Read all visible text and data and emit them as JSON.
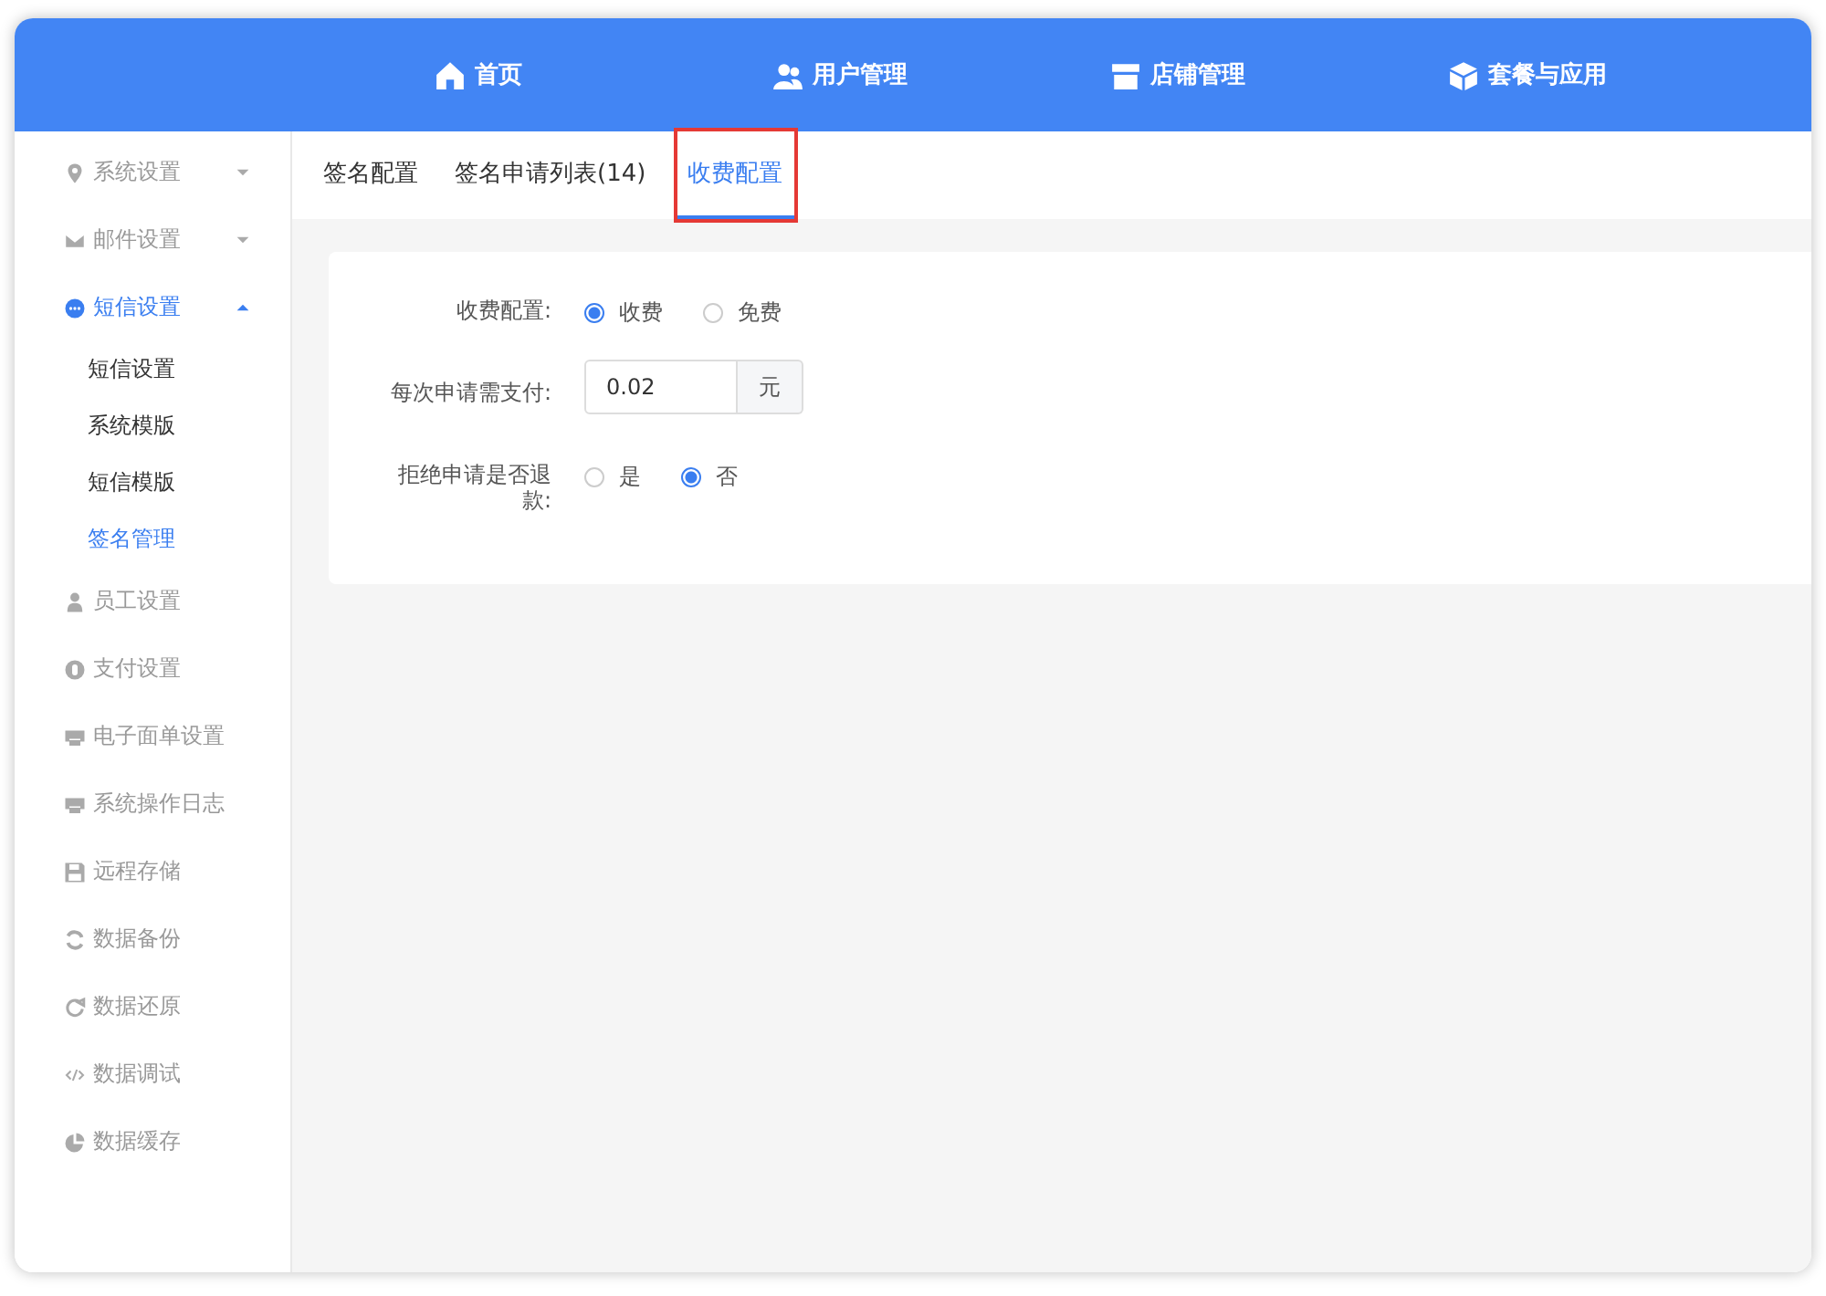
{
  "nav": [
    {
      "label": "首页"
    },
    {
      "label": "用户管理"
    },
    {
      "label": "店铺管理"
    },
    {
      "label": "套餐与应用"
    }
  ],
  "sidebar": {
    "items": [
      {
        "label": "系统设置",
        "selected": false,
        "expanded": false
      },
      {
        "label": "邮件设置",
        "selected": false,
        "expanded": false
      },
      {
        "label": "短信设置",
        "selected": true,
        "expanded": true,
        "children": [
          {
            "label": "短信设置",
            "selected": false
          },
          {
            "label": "系统模版",
            "selected": false
          },
          {
            "label": "短信模版",
            "selected": false
          },
          {
            "label": "签名管理",
            "selected": true
          }
        ]
      },
      {
        "label": "员工设置",
        "selected": false
      },
      {
        "label": "支付设置",
        "selected": false
      },
      {
        "label": "电子面单设置",
        "selected": false
      },
      {
        "label": "系统操作日志",
        "selected": false
      },
      {
        "label": "远程存储",
        "selected": false
      },
      {
        "label": "数据备份",
        "selected": false
      },
      {
        "label": "数据还原",
        "selected": false
      },
      {
        "label": "数据调试",
        "selected": false
      },
      {
        "label": "数据缓存",
        "selected": false
      }
    ]
  },
  "tabs": [
    {
      "label": "签名配置",
      "selected": false,
      "highlighted": false
    },
    {
      "label": "签名申请列表(14)",
      "selected": false,
      "highlighted": false
    },
    {
      "label": "收费配置",
      "selected": true,
      "highlighted": true
    }
  ],
  "form": {
    "fields": [
      {
        "kind": "radio",
        "label": "收费配置:",
        "options": [
          {
            "label": "收费",
            "selected": true
          },
          {
            "label": "免费",
            "selected": false
          }
        ]
      },
      {
        "kind": "input",
        "label": "每次申请需支付:",
        "value": "0.02",
        "suffix": "元"
      },
      {
        "kind": "radio",
        "label": "拒绝申请是否退款:",
        "options": [
          {
            "label": "是",
            "selected": false
          },
          {
            "label": "否",
            "selected": true
          }
        ]
      }
    ]
  }
}
